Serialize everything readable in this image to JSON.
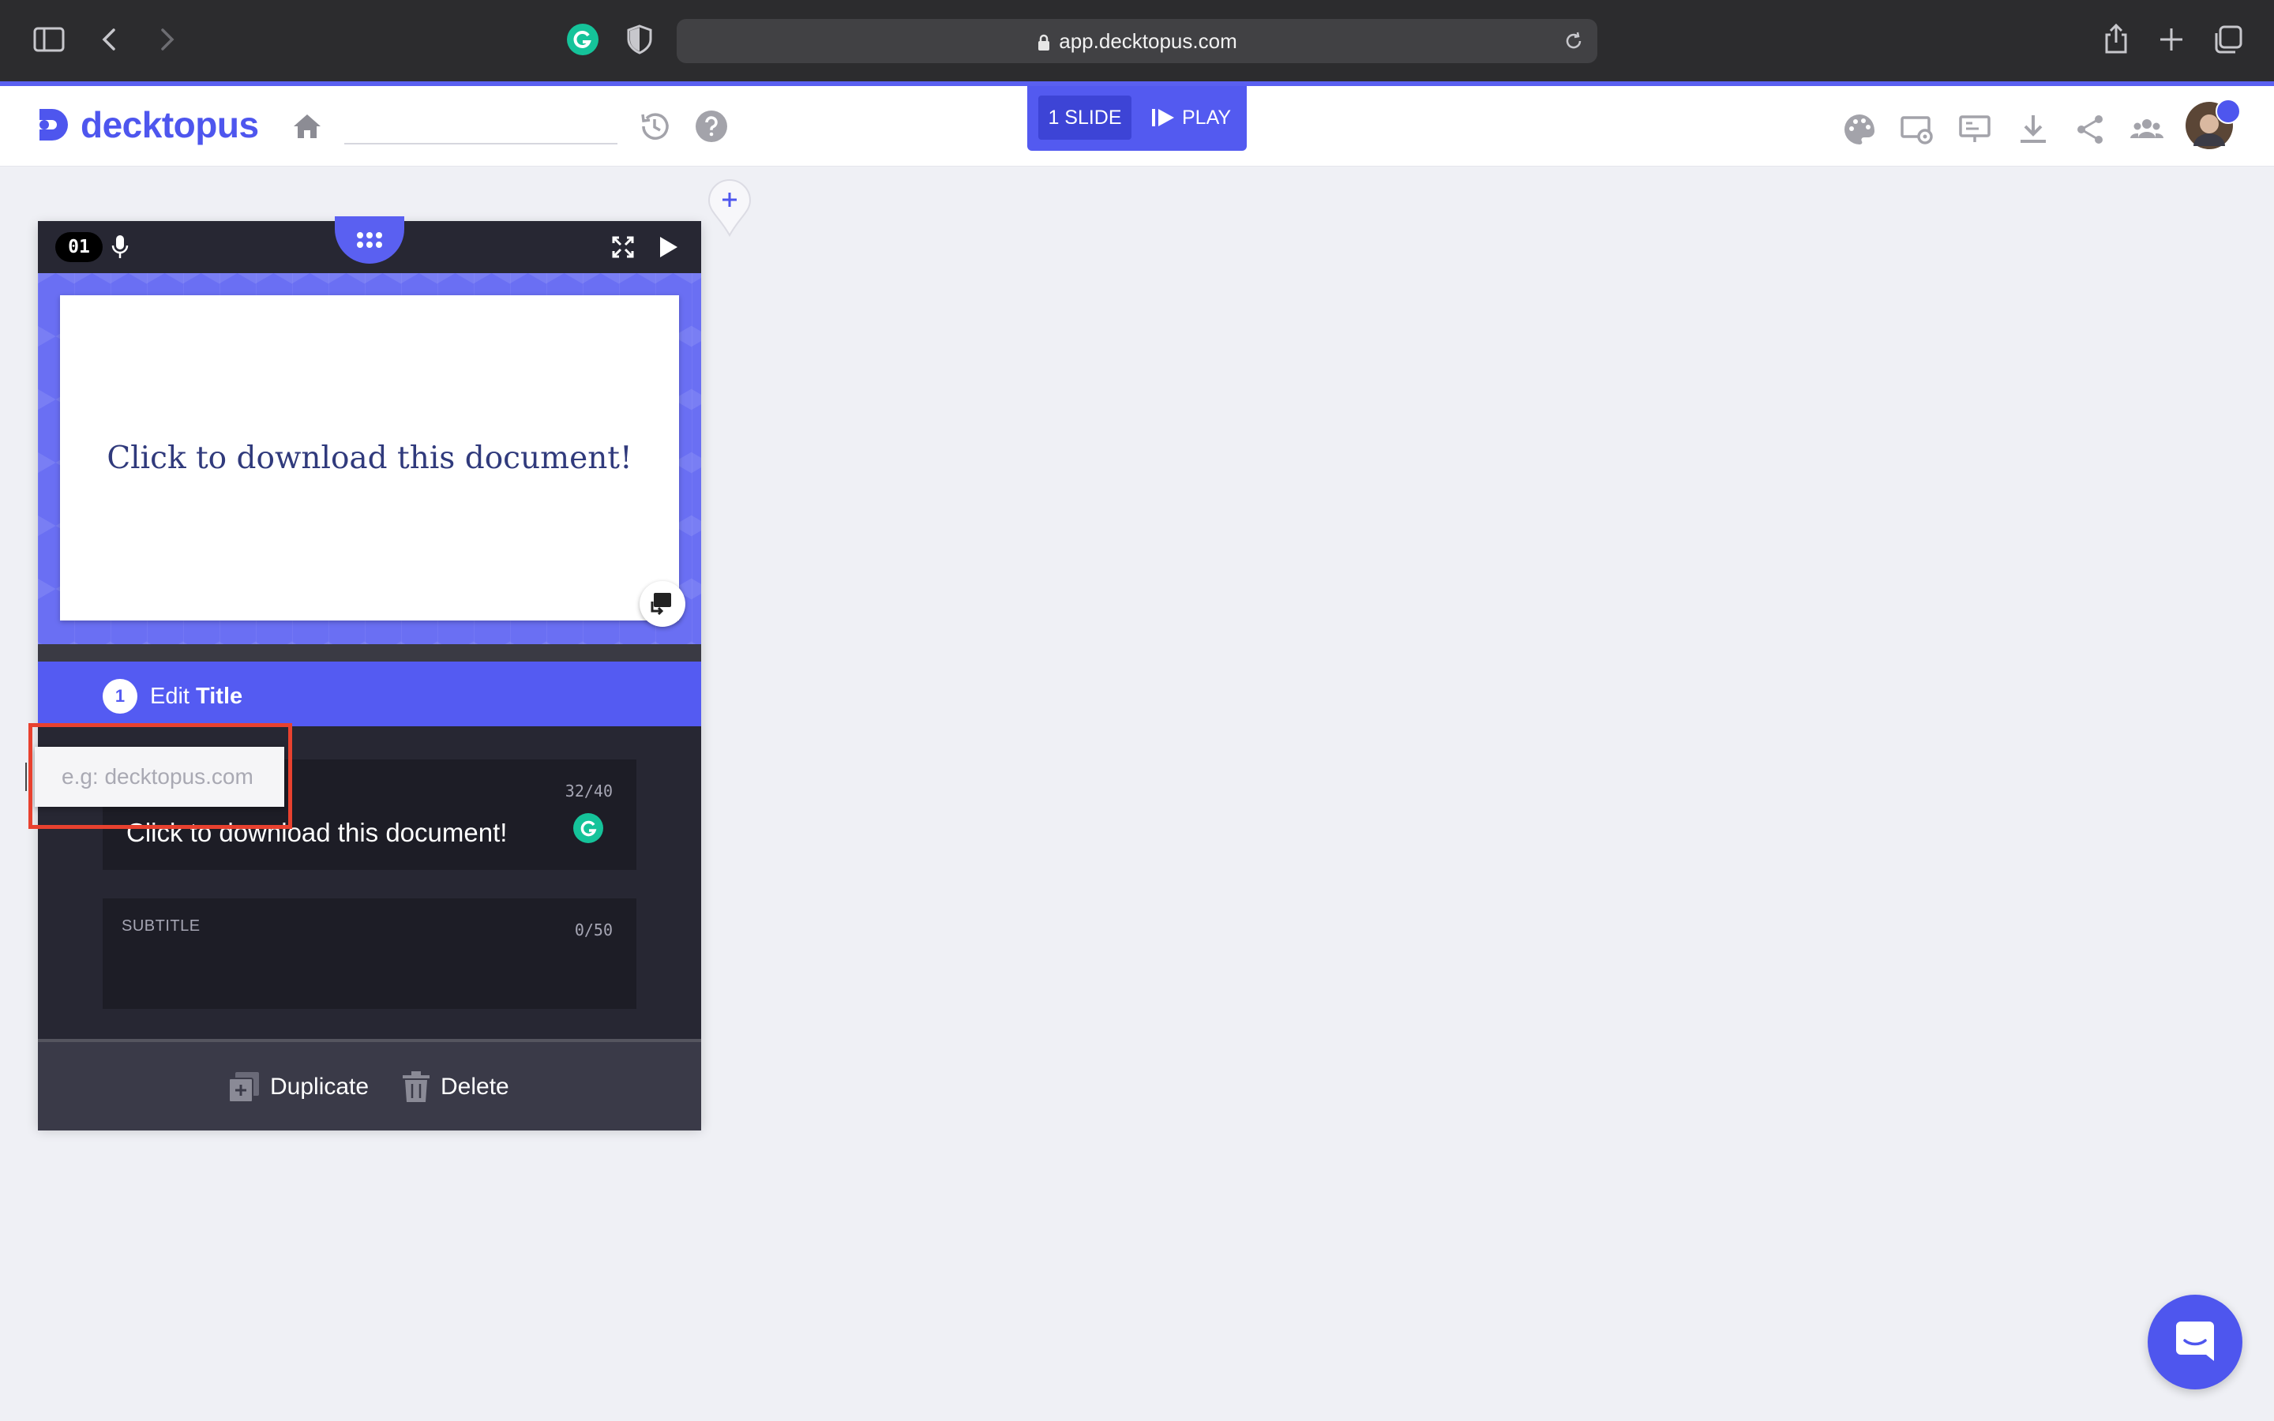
{
  "browser": {
    "url": "app.decktopus.com"
  },
  "header": {
    "brand": "decktopus",
    "slide_count": "1 SLIDE",
    "play_label": "PLAY",
    "accent_color": "#4e56ee"
  },
  "slide": {
    "number": "01",
    "canvas_title": "Click to download this document!",
    "edit_step": "1",
    "edit_prefix": "Edit",
    "edit_target": "Title",
    "title_field": {
      "label": "",
      "count": "32/40",
      "value": "Click to download this document!"
    },
    "subtitle_field": {
      "label": "SUBTITLE",
      "count": "0/50",
      "value": ""
    },
    "duplicate_label": "Duplicate",
    "delete_label": "Delete"
  },
  "link_popover": {
    "placeholder": "e.g: decktopus.com",
    "value": ""
  },
  "colors": {
    "highlight": "#e8412f",
    "grammarly": "#15c39a"
  }
}
